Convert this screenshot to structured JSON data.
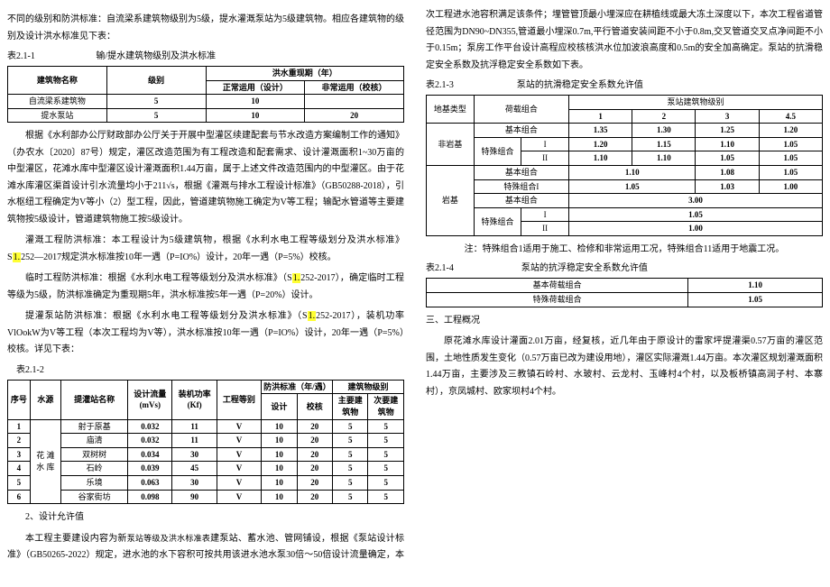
{
  "col1": {
    "p1": "不同的级别和防洪标准：自流梁系建筑物级别为5级，提水灌溉泵站为5级建筑物。相应各建筑物的级别及设计洪水标准见下表：",
    "t1_label": "表2.1-1                           输/提水建筑物级别及洪水标准",
    "t1": {
      "h1": "建筑物名称",
      "h2": "级别",
      "h3": "洪水重现期（年）",
      "h3a": "正常运用（设计）",
      "h3b": "非常运用（校核）",
      "r1c1": "自流梁系建筑物",
      "r1c2": "5",
      "r1c3": "10",
      "r1c4": "",
      "r2c1": "提水泵站",
      "r2c2": "5",
      "r2c3": "10",
      "r2c4": "20"
    },
    "p2": "根据《水利部办公厅财政部办公厅关于开展中型灌区续建配套与节水改造方案编制工作的通知》（办农水〔2020〕87号）规定，灌区改造范围为有工程改造和配套需求、设计灌溉面积1~30万亩的中型灌区，花滩水库中型灌区设计灌溉面积1.44万亩，属于上述文件改造范围内的中型灌区。由于花滩水库灌区渠首设计引水流量均小于211√s，根据《灌溉与排水工程设计标准》（GB50288-2018），引水枢纽工程确定为V等小（2）型工程，因此，管道建筑物施工确定为V等工程；输配水管道等主要建筑物按5级设计，管道建筑物施工按5级设计。",
    "p3a": "灌溉工程防洪标准：本工程设计为5级建筑物，根据《水利水电工程等级划分及洪水标准》S",
    "p3hl": "1.",
    "p3b": "252—2017规定洪水标准按10年一遇（P=IO%）设计，20年一遇（P=5%）校核。",
    "p4a": "临时工程防洪标准：根据《水利水电工程等级划分及洪水标准》（S",
    "p4hl": "1.",
    "p4b": "252-2017），确定临时工程等级为5级，防洪标准确定为重现期5年，洪水标准按5年一遇（P=20%）设计。",
    "p5a": "提灌泵站防洪标准：根据《水利水电工程等级划分及洪水标准》（S",
    "p5hl": "1.",
    "p5b": "252-2017），装机功率VlOokW为V等工程（本次工程均为V等），洪水标准按10年一遇（P=IO%）设计，20年一遇（P=5%）校核。详见下表：",
    "t2_label": "表2.1-2",
    "t2": {
      "h_no": "序号",
      "h_src": "水源",
      "h_name": "提灌站名称",
      "h_q": "设计流量(mVs)",
      "h_p": "装机功率(Kf)",
      "h_grade": "工程等别",
      "h_flood": "防洪标准（年/遇）",
      "h_design": "设计",
      "h_check": "校核",
      "h_blv": "建筑物级别",
      "h_main": "主要建筑物",
      "h_sec": "次要建筑物",
      "src": "花 滩 水 库",
      "rows": [
        {
          "no": "1",
          "name": "射于原基",
          "q": "0.032",
          "p": "11",
          "g": "V",
          "d": "10",
          "c": "20",
          "m": "5",
          "s": "5"
        },
        {
          "no": "2",
          "name": "庙清",
          "q": "0.032",
          "p": "11",
          "g": "V",
          "d": "10",
          "c": "20",
          "m": "5",
          "s": "5"
        },
        {
          "no": "3",
          "name": "双树树",
          "q": "0.034",
          "p": "30",
          "g": "V",
          "d": "10",
          "c": "20",
          "m": "5",
          "s": "5"
        },
        {
          "no": "4",
          "name": "石岭",
          "q": "0.039",
          "p": "45",
          "g": "V",
          "d": "10",
          "c": "20",
          "m": "5",
          "s": "5"
        },
        {
          "no": "5",
          "name": "乐境",
          "q": "0.063",
          "p": "30",
          "g": "V",
          "d": "10",
          "c": "20",
          "m": "5",
          "s": "5"
        },
        {
          "no": "6",
          "name": "谷家街坊",
          "q": "0.098",
          "p": "90",
          "g": "V",
          "d": "10",
          "c": "20",
          "m": "5",
          "s": "5"
        }
      ]
    }
  },
  "col2": {
    "p_head": "2、设计允许值",
    "p6a": "本工程主要建设内容为新",
    "p6mid": "泵站等级及洪水标准表",
    "p6b": "建泵站、蓄水池、管网铺设，根据《泵站设计标准》（GB50265-2022）规定，进水池的水下容积可按共用该进水池水泵30倍～50倍设计流量确定，本次工程进水池容积满足该条件；埋管管顶最小埋深应在耕植线或最大冻土深度以下，本次工程省道管径范围为DN90~DN355,管道最小埋深0.7m,平行管道安装间距不小于0.8m,交叉管道交叉点净间距不小于0.15m；泵房工作平台设计高程应校核核洪水位加波浪高度和0.5m的安全加高确定。泵站的抗滑稳定安全系数及抗浮稳定安全系数如下表。",
    "t3_label": "表2.1-3                            泵站的抗滑稳定安全系数允许值",
    "t3": {
      "h_foundation": "地基类型",
      "h_load": "荷载组合",
      "h_blv": "泵站建筑物级别",
      "h_1": "1",
      "h_2": "2",
      "h_3": "3",
      "h_45": "4.5",
      "rg1": "非岩基",
      "rg1r1": {
        "l": "基本组合",
        "v1": "1.35",
        "v2": "1.30",
        "v3": "1.25",
        "v4": "1.20"
      },
      "rg1s": "特殊组合",
      "rg1r2": {
        "l": "I",
        "v1": "1.20",
        "v2": "1.15",
        "v3": "1.10",
        "v4": "1.05"
      },
      "rg1r3": {
        "l": "II",
        "v1": "1.10",
        "v2": "1.10",
        "v3": "1.05",
        "v4": "1.05"
      },
      "rg2": "岩基",
      "rg2r1": {
        "l": "基本组合",
        "v12": "1.10",
        "v3": "1.08",
        "v4": "1.05"
      },
      "rg2r2": {
        "l": "特殊组合I",
        "v12": "1.05",
        "v3": "1.03",
        "v4": "1.00"
      },
      "rg2s": "特殊组合",
      "rg2rI": {
        "l": "I",
        "v1234": "1.05"
      },
      "rg2b": {
        "l": "基本组合",
        "v1234": "3.00"
      },
      "rg2rII": {
        "l": "II",
        "v1234": "1.00"
      }
    },
    "note": "注：特殊组合1适用于施工、检修和非常运用工况，特殊组合11适用于地震工况。",
    "t4_label": "表2.1-4                              泵站的抗浮稳定安全系数允许值",
    "t4": {
      "r1l": "基本荷载组合",
      "r1v": "1.10",
      "r2l": "特殊荷载组合",
      "r2v": "1.05"
    },
    "p_sec": "三、工程概况",
    "p7": "原花滩水库设计灌面2.01万亩，经复核，近几年由于原设计的雷家坪提灌渠0.57万亩的灌区范围，土地性质发生变化（0.57万亩已改为建设用地），灌区实际灌溉1.44万亩。本次灌区规划灌溉面积1.44万亩，主要涉及三教镇石岭村、水玻村、云龙村、玉峰村4个村，以及板桥镇高润子村、本寨村），京凤城村、欧家坝村4个村。"
  }
}
